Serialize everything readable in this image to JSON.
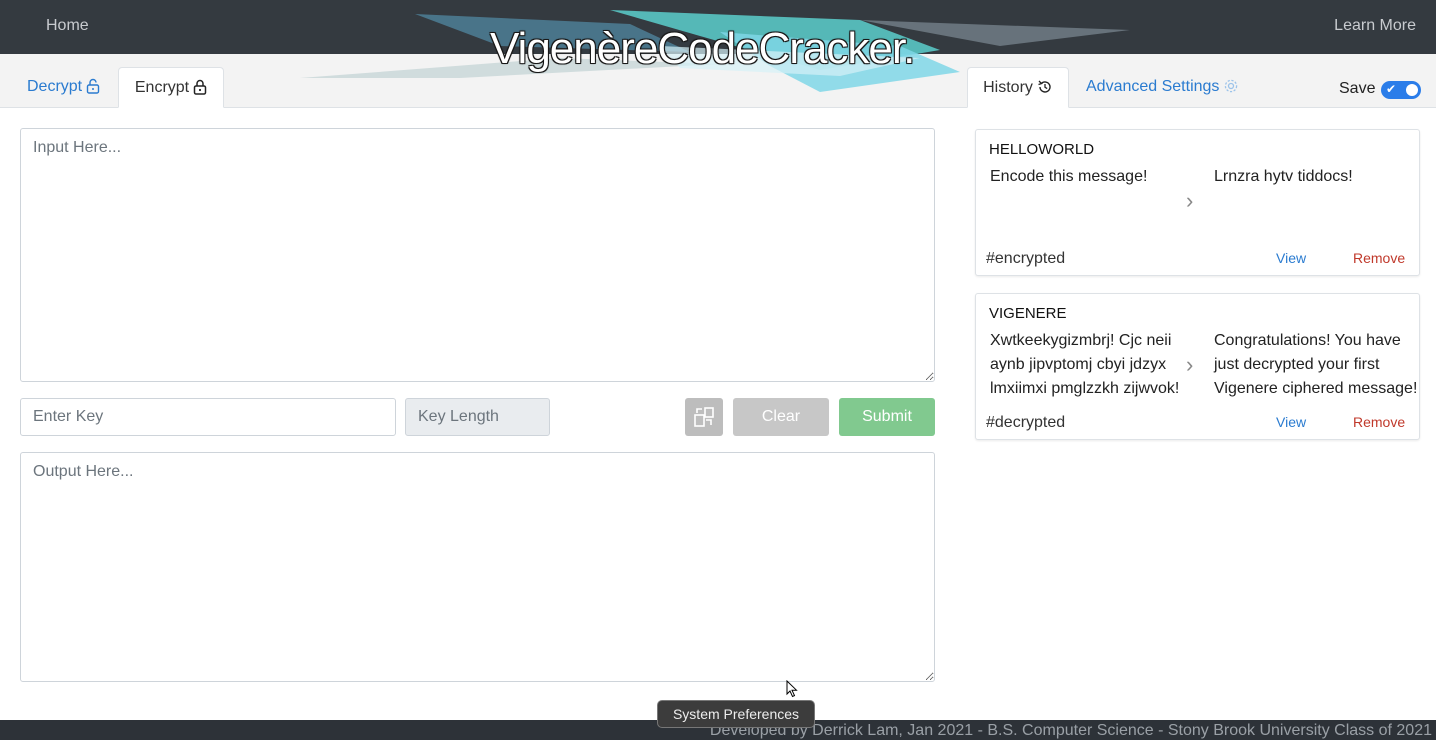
{
  "nav": {
    "home": "Home",
    "learn_more": "Learn More",
    "logo": "VigenèreCodeCracker."
  },
  "tabs": {
    "decrypt": "Decrypt",
    "encrypt": "Encrypt",
    "history": "History",
    "advanced": "Advanced Settings"
  },
  "save": {
    "label": "Save",
    "enabled": true
  },
  "form": {
    "input_placeholder": "Input Here...",
    "key_placeholder": "Enter Key",
    "key_length_placeholder": "Key Length",
    "output_placeholder": "Output Here...",
    "clear_label": "Clear",
    "submit_label": "Submit"
  },
  "history": [
    {
      "key": "HELLOWORLD",
      "input": "Encode this message!",
      "output": "Lrnzra hytv tiddocs!",
      "tag": "#encrypted",
      "view": "View",
      "remove": "Remove"
    },
    {
      "key": "VIGENERE",
      "input": "Xwtkeekygizmbrj! Cjc neii aynb jipvptomj cbyi jdzyx lmxiimxi pmglzzkh zijwvok!",
      "output": "Congratulations! You have just decrypted your first Vigenere ciphered message!",
      "tag": "#decrypted",
      "view": "View",
      "remove": "Remove"
    }
  ],
  "footer": "Developed by Derrick Lam, Jan 2021 - B.S. Computer Science - Stony Brook University Class of 2021",
  "tooltip": "System Preferences",
  "colors": {
    "navbar": "#343a40",
    "link": "#2a7bd0",
    "submit": "#81c98f",
    "remove": "#c0392b",
    "toggle": "#2b7de9"
  }
}
